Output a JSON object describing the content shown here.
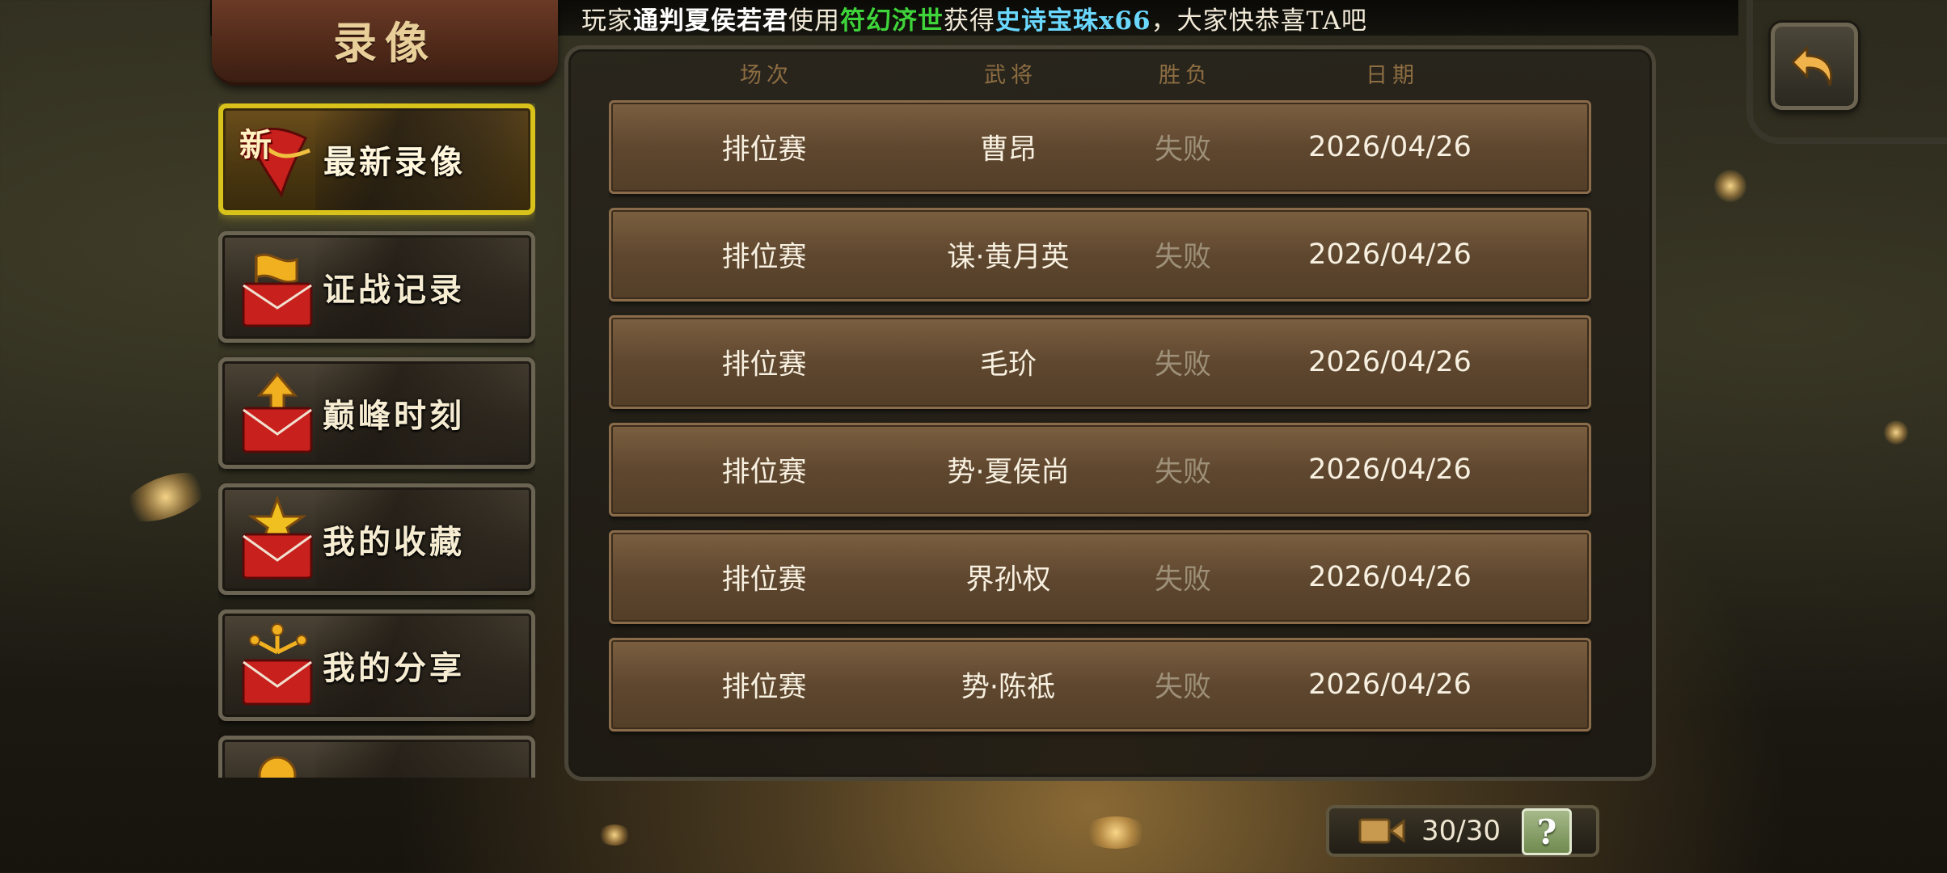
{
  "banner": {
    "prefix": "玩家",
    "player": "通判夏侯若君",
    "mid1": "使用",
    "item": "符幻济世",
    "mid2": "获得",
    "reward": "史诗宝珠x66",
    "suffix": "，大家快恭喜TA吧"
  },
  "title": "录像",
  "menu": {
    "items": [
      {
        "label": "最新录像",
        "badge": "新"
      },
      {
        "label": "证战记录"
      },
      {
        "label": "巅峰时刻"
      },
      {
        "label": "我的收藏"
      },
      {
        "label": "我的分享"
      },
      {
        "label": ""
      }
    ]
  },
  "table": {
    "headers": [
      "场次",
      "武将",
      "胜负",
      "日期"
    ],
    "rows": [
      {
        "mode": "排位赛",
        "general": "曹昂",
        "result": "失败",
        "date": "2026/04/26"
      },
      {
        "mode": "排位赛",
        "general": "谋·黄月英",
        "result": "失败",
        "date": "2026/04/26"
      },
      {
        "mode": "排位赛",
        "general": "毛玠",
        "result": "失败",
        "date": "2026/04/26"
      },
      {
        "mode": "排位赛",
        "general": "势·夏侯尚",
        "result": "失败",
        "date": "2026/04/26"
      },
      {
        "mode": "排位赛",
        "general": "界孙权",
        "result": "失败",
        "date": "2026/04/26"
      },
      {
        "mode": "排位赛",
        "general": "势·陈祗",
        "result": "失败",
        "date": "2026/04/26"
      }
    ]
  },
  "footer": {
    "count": "30/30",
    "help": "?"
  },
  "colors": {
    "active_border": "#d9c21a",
    "item_green": "#3ed43a",
    "reward_cyan": "#6ad8ff",
    "result_gray": "#9d8f78",
    "header_brown": "#8d6d42"
  }
}
